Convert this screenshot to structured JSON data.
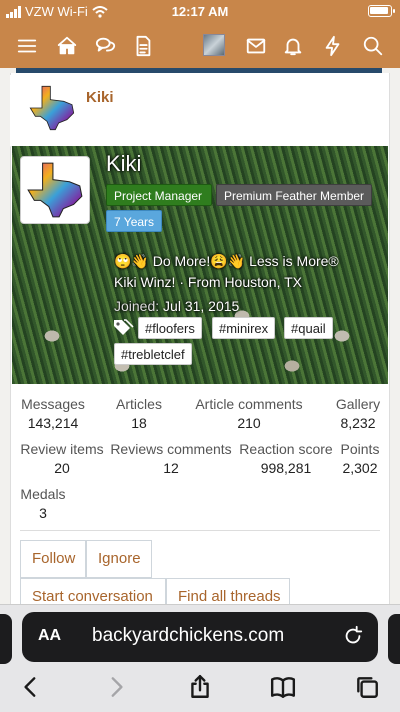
{
  "status_bar": {
    "carrier": "VZW Wi-Fi",
    "time": "12:17 AM",
    "battery_level": 0.95
  },
  "nav": {
    "icons": [
      "menu-icon",
      "home-icon",
      "chat-icon",
      "document-icon",
      "user-avatar",
      "mail-icon",
      "bell-icon",
      "lightning-icon",
      "search-icon"
    ]
  },
  "post_header": {
    "username": "Kiki"
  },
  "member_card": {
    "name": "Kiki",
    "badges": {
      "project_manager": "Project Manager",
      "premium": "Premium Feather Member",
      "years": "7 Years"
    },
    "motto": "🙄👋 Do More!😩👋 Less is More®",
    "location_line": "Kiki Winz! · From Houston, TX",
    "joined_label": "Joined:",
    "joined_date": "Jul 31, 2015",
    "tags": [
      "#floofers",
      "#minirex",
      "#quail",
      "#trebletclef"
    ]
  },
  "stats": {
    "messages": {
      "label": "Messages",
      "value": "143,214"
    },
    "articles": {
      "label": "Articles",
      "value": "18"
    },
    "article_comments": {
      "label": "Article comments",
      "value": "210"
    },
    "gallery": {
      "label": "Gallery",
      "value": "8,232"
    },
    "review_items": {
      "label": "Review items",
      "value": "20"
    },
    "reviews_comments": {
      "label": "Reviews comments",
      "value": "12"
    },
    "reaction_score": {
      "label": "Reaction score",
      "value": "998,281"
    },
    "points": {
      "label": "Points",
      "value": "2,302"
    },
    "medals": {
      "label": "Medals",
      "value": "3"
    }
  },
  "actions": {
    "follow": "Follow",
    "ignore": "Ignore",
    "start_conversation": "Start conversation",
    "find_threads": "Find all threads"
  },
  "safari": {
    "aa_label": "AA",
    "url": "backyardchickens.com"
  },
  "colors": {
    "brand": "#c8864a",
    "accent_text": "#a8652c",
    "nav_underline": "#274a6b",
    "project_manager": "#2f7d1e",
    "premium": "#5b5b5b",
    "years": "#5aa7dd"
  }
}
